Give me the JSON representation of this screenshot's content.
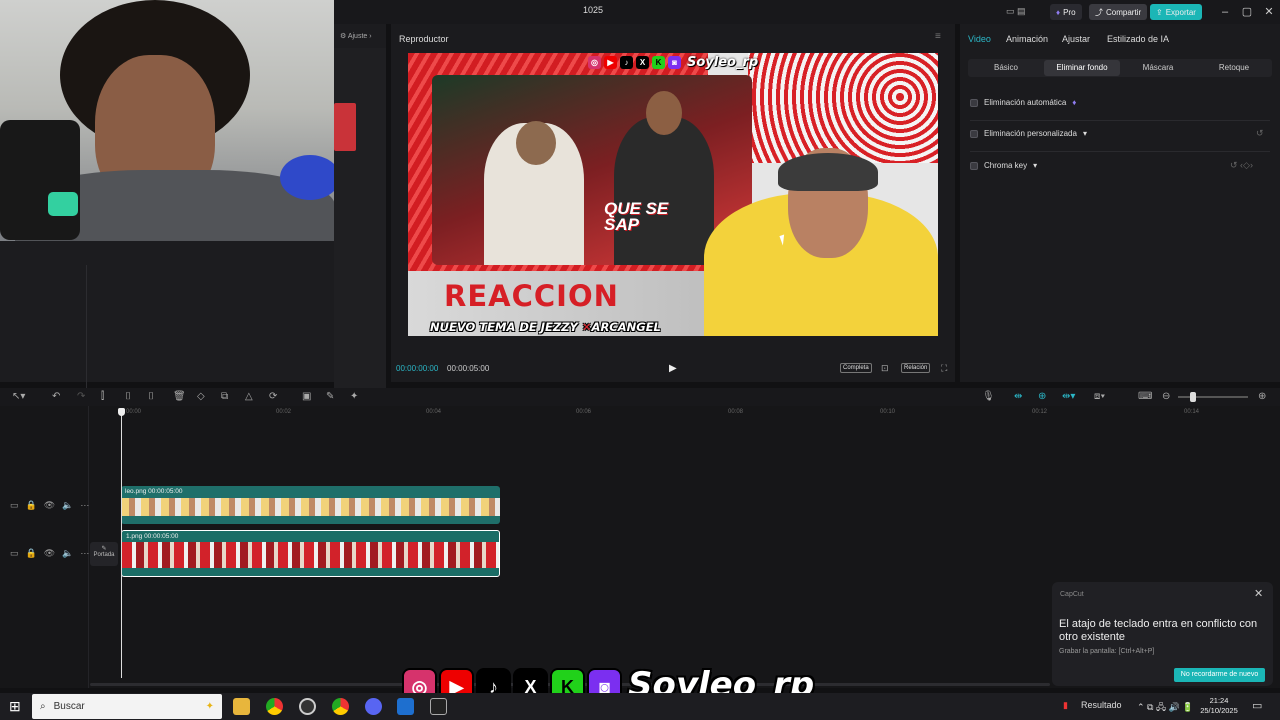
{
  "window": {
    "title": "1025",
    "pro_label": "Pro",
    "share_label": "Compartir",
    "export_label": "Exportar"
  },
  "player": {
    "title": "Reproductor",
    "current_time": "00:00:00:00",
    "total_time": "00:00:05:00",
    "complete_label": "Completa",
    "ratio_label": "Relación"
  },
  "preview": {
    "handle": "Soyleo_rp",
    "heading": "REACCION",
    "subheading_a": "NUEVO TEMA DE JEZZY",
    "subheading_x": "✕",
    "subheading_b": "ARCANGEL",
    "song": "QUE SE SAP"
  },
  "inspector": {
    "tabs": [
      "Video",
      "Animación",
      "Ajustar",
      "Estilizado de IA"
    ],
    "subtabs": [
      "Básico",
      "Eliminar fondo",
      "Máscara",
      "Retoque"
    ],
    "options": [
      "Eliminación automática",
      "Eliminación personalizada",
      "Chroma key"
    ]
  },
  "ruler": [
    "00:00",
    "00:02",
    "00:04",
    "00:06",
    "00:08",
    "00:10",
    "00:12",
    "00:14"
  ],
  "clips": {
    "clip1_label": "leo.png   00:00:05:00",
    "clip2_label": "1.png   00:00:05:00",
    "cover_label": "Portada"
  },
  "notification": {
    "app": "CapCut",
    "message": "El atajo de teclado entra en conflicto con otro existente",
    "shortcut": "Grabar la pantalla: [Ctrl+Alt+P]",
    "button": "No recordarme de nuevo"
  },
  "overlay": {
    "handle": "Soyleo_rp"
  },
  "taskbar": {
    "search_placeholder": "Buscar",
    "result_label": "Resultado",
    "time": "21:24",
    "date": "25/10/2025"
  },
  "colors": {
    "accent": "#1bb6b6",
    "pro": "#6b57d6",
    "red": "#d61f26"
  }
}
